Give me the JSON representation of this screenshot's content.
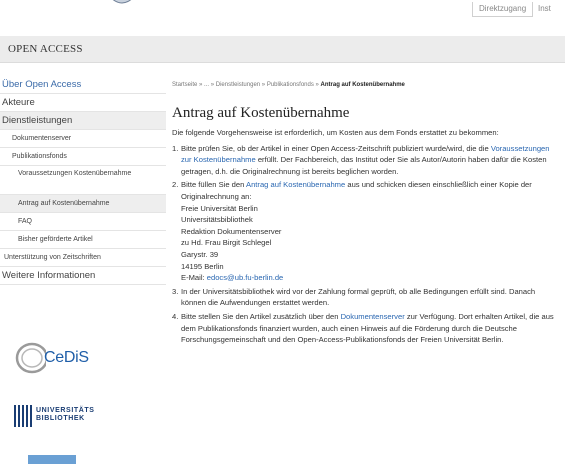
{
  "header": {
    "top_link": "Direktzugang",
    "top_link2": "Inst"
  },
  "banner": {
    "title": "OPEN ACCESS"
  },
  "nav": {
    "item0": "Über Open Access",
    "item1": "Akteure",
    "item2": "Dienstleistungen",
    "item3": "Dokumentenserver",
    "item4": "Publikationsfonds",
    "item5": "Voraussetzungen Kostenübernahme",
    "item6": "Antrag auf Kostenübernahme",
    "item7": "FAQ",
    "item8": "Bisher geförderte Artikel",
    "item9": "Unterstützung von Zeitschriften",
    "item10": "Weitere Informationen"
  },
  "logos": {
    "cedis": "CeDiS",
    "ub_line1": "UNIVERSITÄTS",
    "ub_line2": "BIBLIOTHEK"
  },
  "breadcrumb": {
    "home": "Startseite",
    "sep": "»",
    "ellipsis": "...",
    "c1": "Dienstleistungen",
    "c2": "Publikationsfonds",
    "current": "Antrag auf Kostenübernahme"
  },
  "page": {
    "title": "Antrag auf Kostenübernahme",
    "intro": "Die folgende Vorgehensweise ist erforderlich, um Kosten aus dem Fonds erstattet zu bekommen:",
    "step1_num": "1.",
    "step1_a": "Bitte prüfen Sie, ob der Artikel in einer Open Access-Zeitschrift publiziert wurde/wird, die die ",
    "step1_link": "Voraussetzungen zur Kostenübernahme",
    "step1_b": " erfüllt. Der Fachbereich, das Institut oder Sie als Autor/Autorin haben dafür die Kosten getragen, d.h. die Originalrechnung ist bereits beglichen worden.",
    "step2_num": "2.",
    "step2_a": "Bitte füllen Sie den ",
    "step2_link": "Antrag auf Kostenübernahme",
    "step2_b": " aus und schicken diesen einschließlich einer Kopie der Originalrechnung an:",
    "addr1": "Freie Universität Berlin",
    "addr2": "Universitätsbibliothek",
    "addr3": "Redaktion Dokumentenserver",
    "addr4": "zu Hd. Frau Birgit Schlegel",
    "addr5": "Garystr. 39",
    "addr6": "14195 Berlin",
    "email_label": "E-Mail: ",
    "email": "edocs@ub.fu-berlin.de",
    "step3_num": "3.",
    "step3": "In der Universitätsbibliothek wird vor der Zahlung formal geprüft, ob alle Bedingungen erfüllt sind. Danach können die Aufwendungen erstattet werden.",
    "step4_num": "4.",
    "step4_a": "Bitte stellen Sie den Artikel zusätzlich über den ",
    "step4_link": "Dokumentenserver",
    "step4_b": " zur Verfügung. Dort erhalten Artikel, die aus dem Publikationsfonds finanziert wurden, auch einen Hinweis auf die Förderung durch die Deutsche Forschungsgemeinschaft und den Open-Access-Publikationsfonds der Freien Universität Berlin."
  },
  "colors": {
    "link": "#2a67b1",
    "banner": "#ececec",
    "nav_active": "#eeeeee",
    "logo_blue": "#1f5ea8"
  }
}
